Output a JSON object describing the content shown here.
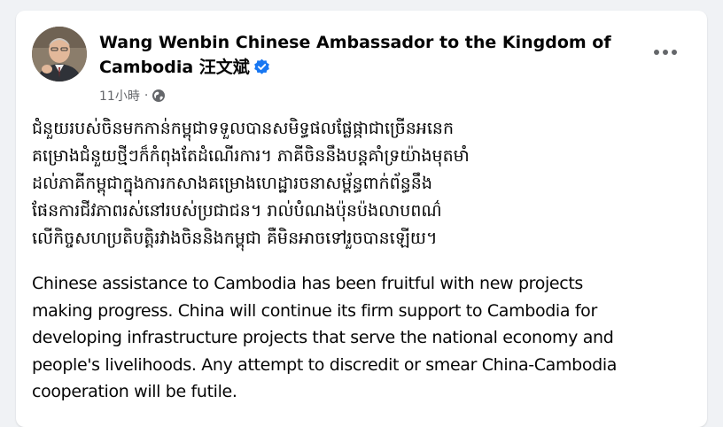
{
  "post": {
    "author": {
      "name": "Wang Wenbin Chinese Ambassador to the Kingdom of Cambodia 汪文斌",
      "verified": true,
      "verified_color": "#1877f2"
    },
    "timestamp": "11小時",
    "separator": "·",
    "audience_icon": "globe-icon",
    "more_icon": "more-options-icon",
    "text_khmer": "ជំនួយរបស់ចិនមកកាន់កម្ពុជាទទួលបានសមិទ្ធផលផ្លែផ្កាជាច្រើនអនេក\nគម្រោងជំនួយថ្មីៗក៏កំពុងតែដំណើរការ។ ភាគីចិននឹងបន្តគាំទ្រយ៉ាងមុតមាំ\nដល់ភាគីកម្ពុជាក្នុងការកសាងគម្រោងហេដ្ឋារចនាសម្ព័ន្ធពាក់ព័ន្ធនឹង\nផែនការជីវភាពរស់នៅរបស់ប្រជាជន។ រាល់បំណងប៉ុនប៉ងលាបពណ៌\nលើកិច្ចសហប្រតិបត្តិរវាងចិននិងកម្ពុជា គឺមិនអាចទៅរួចបានឡើយ។",
    "text_english": "Chinese assistance to Cambodia has been fruitful with new projects\nmaking progress. China will continue its firm support to Cambodia for\ndeveloping infrastructure projects that serve the national economy and\npeople's livelihoods. Any attempt to discredit or smear China-Cambodia\ncooperation will be futile."
  }
}
